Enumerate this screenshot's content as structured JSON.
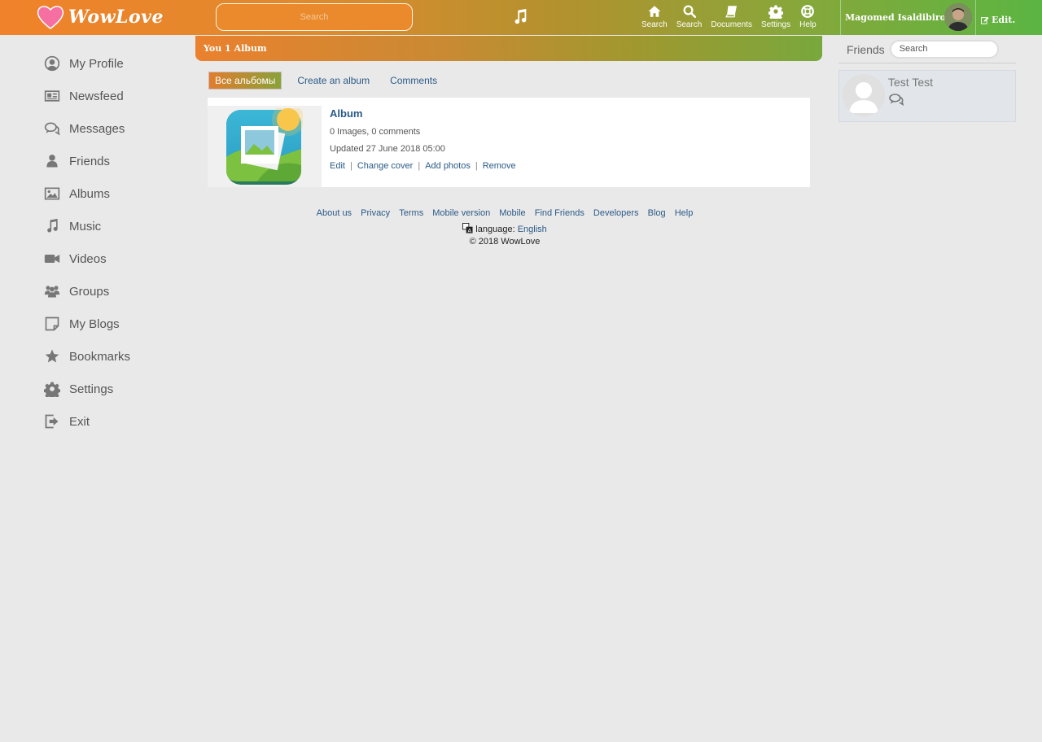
{
  "header": {
    "brand": "WowLove",
    "search_placeholder": "Search",
    "nav": [
      {
        "label": "Search",
        "icon": "home-icon"
      },
      {
        "label": "Search",
        "icon": "search-icon"
      },
      {
        "label": "Documents",
        "icon": "book-icon"
      },
      {
        "label": "Settings",
        "icon": "gear-icon"
      },
      {
        "label": "Help",
        "icon": "lifebuoy-icon"
      }
    ],
    "user_name": "Magomed Isaldibirov",
    "edit_label": "Edit."
  },
  "sidebar": {
    "items": [
      {
        "label": "My Profile",
        "icon": "user-circle-icon"
      },
      {
        "label": "Newsfeed",
        "icon": "newspaper-icon"
      },
      {
        "label": "Messages",
        "icon": "chat-icon"
      },
      {
        "label": "Friends",
        "icon": "user-icon"
      },
      {
        "label": "Albums",
        "icon": "image-icon"
      },
      {
        "label": "Music",
        "icon": "music-icon"
      },
      {
        "label": "Videos",
        "icon": "video-icon"
      },
      {
        "label": "Groups",
        "icon": "group-icon"
      },
      {
        "label": "My Blogs",
        "icon": "note-icon"
      },
      {
        "label": "Bookmarks",
        "icon": "star-icon"
      },
      {
        "label": "Settings",
        "icon": "gear-icon"
      },
      {
        "label": "Exit",
        "icon": "exit-icon"
      }
    ]
  },
  "main": {
    "header_title": "You 1 Album",
    "tabs": {
      "active": "Все альбомы",
      "create": "Create an album",
      "comments": "Comments"
    },
    "album": {
      "title": "Album",
      "stats": "0 Images, 0 comments",
      "updated": "Updated 27 June 2018 05:00",
      "actions": {
        "edit": "Edit",
        "change_cover": "Change cover",
        "add_photos": "Add photos",
        "remove": "Remove"
      }
    }
  },
  "footer": {
    "links": [
      "About us",
      "Privacy",
      "Terms",
      "Mobile version",
      "Mobile",
      "Find Friends",
      "Developers",
      "Blog",
      "Help"
    ],
    "language_label": "language:",
    "language_value": "English",
    "copyright": "© 2018 WowLove"
  },
  "friends": {
    "title": "Friends",
    "search_placeholder": "Search",
    "list": [
      {
        "name": "Test Test"
      }
    ]
  },
  "colors": {
    "brand_orange": "#f0822a",
    "brand_green": "#5bb542",
    "link": "#2b5a86"
  }
}
